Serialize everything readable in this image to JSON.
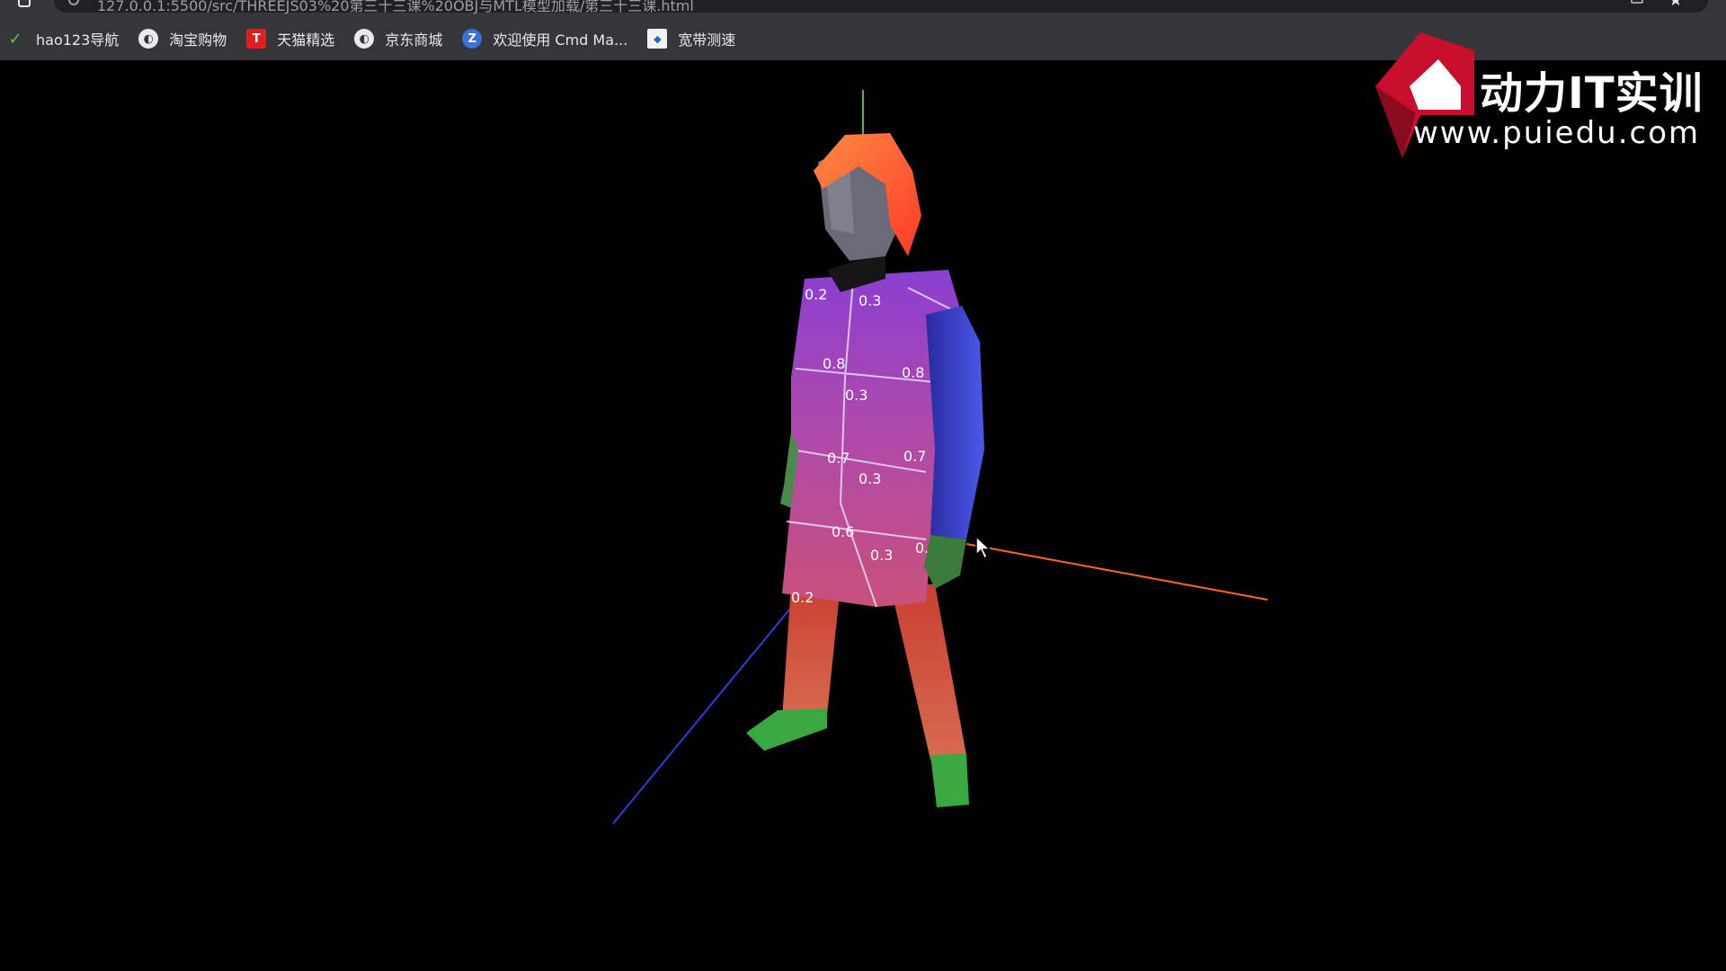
{
  "browser": {
    "url": "127.0.0.1:5500/src/THREEJS03%20第三十三课%20OBJ与MTL模型加载/第三十三课.html"
  },
  "bookmarks": [
    {
      "label": "hao123导航",
      "icon": "hao-icon"
    },
    {
      "label": "淘宝购物",
      "icon": "globe-icon"
    },
    {
      "label": "天猫精选",
      "icon": "tmall-icon"
    },
    {
      "label": "京东商城",
      "icon": "globe-icon"
    },
    {
      "label": "欢迎使用 Cmd Ma...",
      "icon": "cmd-icon"
    },
    {
      "label": "宽带测速",
      "icon": "speedtest-icon"
    }
  ],
  "watermark": {
    "title": "动力IT实训",
    "url": "www.puiedu.com",
    "brand_color": "#c8102e"
  },
  "scene": {
    "background": "#000000",
    "axis_colors": {
      "x": "#ff6a1a",
      "y": "#3fbf3f",
      "z": "#2a3fe0"
    },
    "uv_labels": [
      "0.2",
      "0.3",
      "0.8",
      "0.3",
      "0.8",
      "0.7",
      "0.3",
      "0.7",
      "0.6",
      "0.3",
      "0.6",
      "0.2"
    ]
  }
}
